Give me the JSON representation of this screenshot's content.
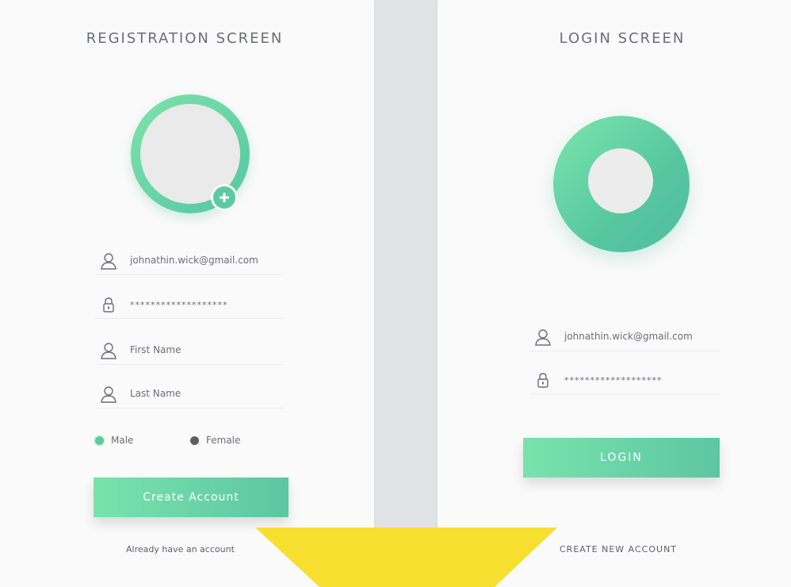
{
  "registration": {
    "title": "REGISTRATION SCREEN",
    "email_value": "johnathin.wick@gmail.com",
    "password_value": "*******************",
    "first_name_placeholder": "First Name",
    "last_name_placeholder": "Last Name",
    "gender": {
      "options": [
        {
          "label": "Male",
          "selected": true
        },
        {
          "label": "Female",
          "selected": false
        }
      ]
    },
    "create_account_label": "Create Account",
    "already_account_link": "Already have an account"
  },
  "login": {
    "title": "LOGIN SCREEN",
    "email_value": "johnathin.wick@gmail.com",
    "password_value": "*******************",
    "login_label": "LOGIN",
    "create_new_link": "CREATE NEW ACCOUNT"
  },
  "colors": {
    "accent_start": "#78e3ac",
    "accent_end": "#5dc6a3",
    "overlay_yellow": "#f7df2f",
    "radio_selected": "#5bcaa2",
    "radio_unselected": "#5a5f6a"
  },
  "icons": {
    "user": "user-icon",
    "lock": "lock-icon",
    "add": "plus-icon"
  }
}
